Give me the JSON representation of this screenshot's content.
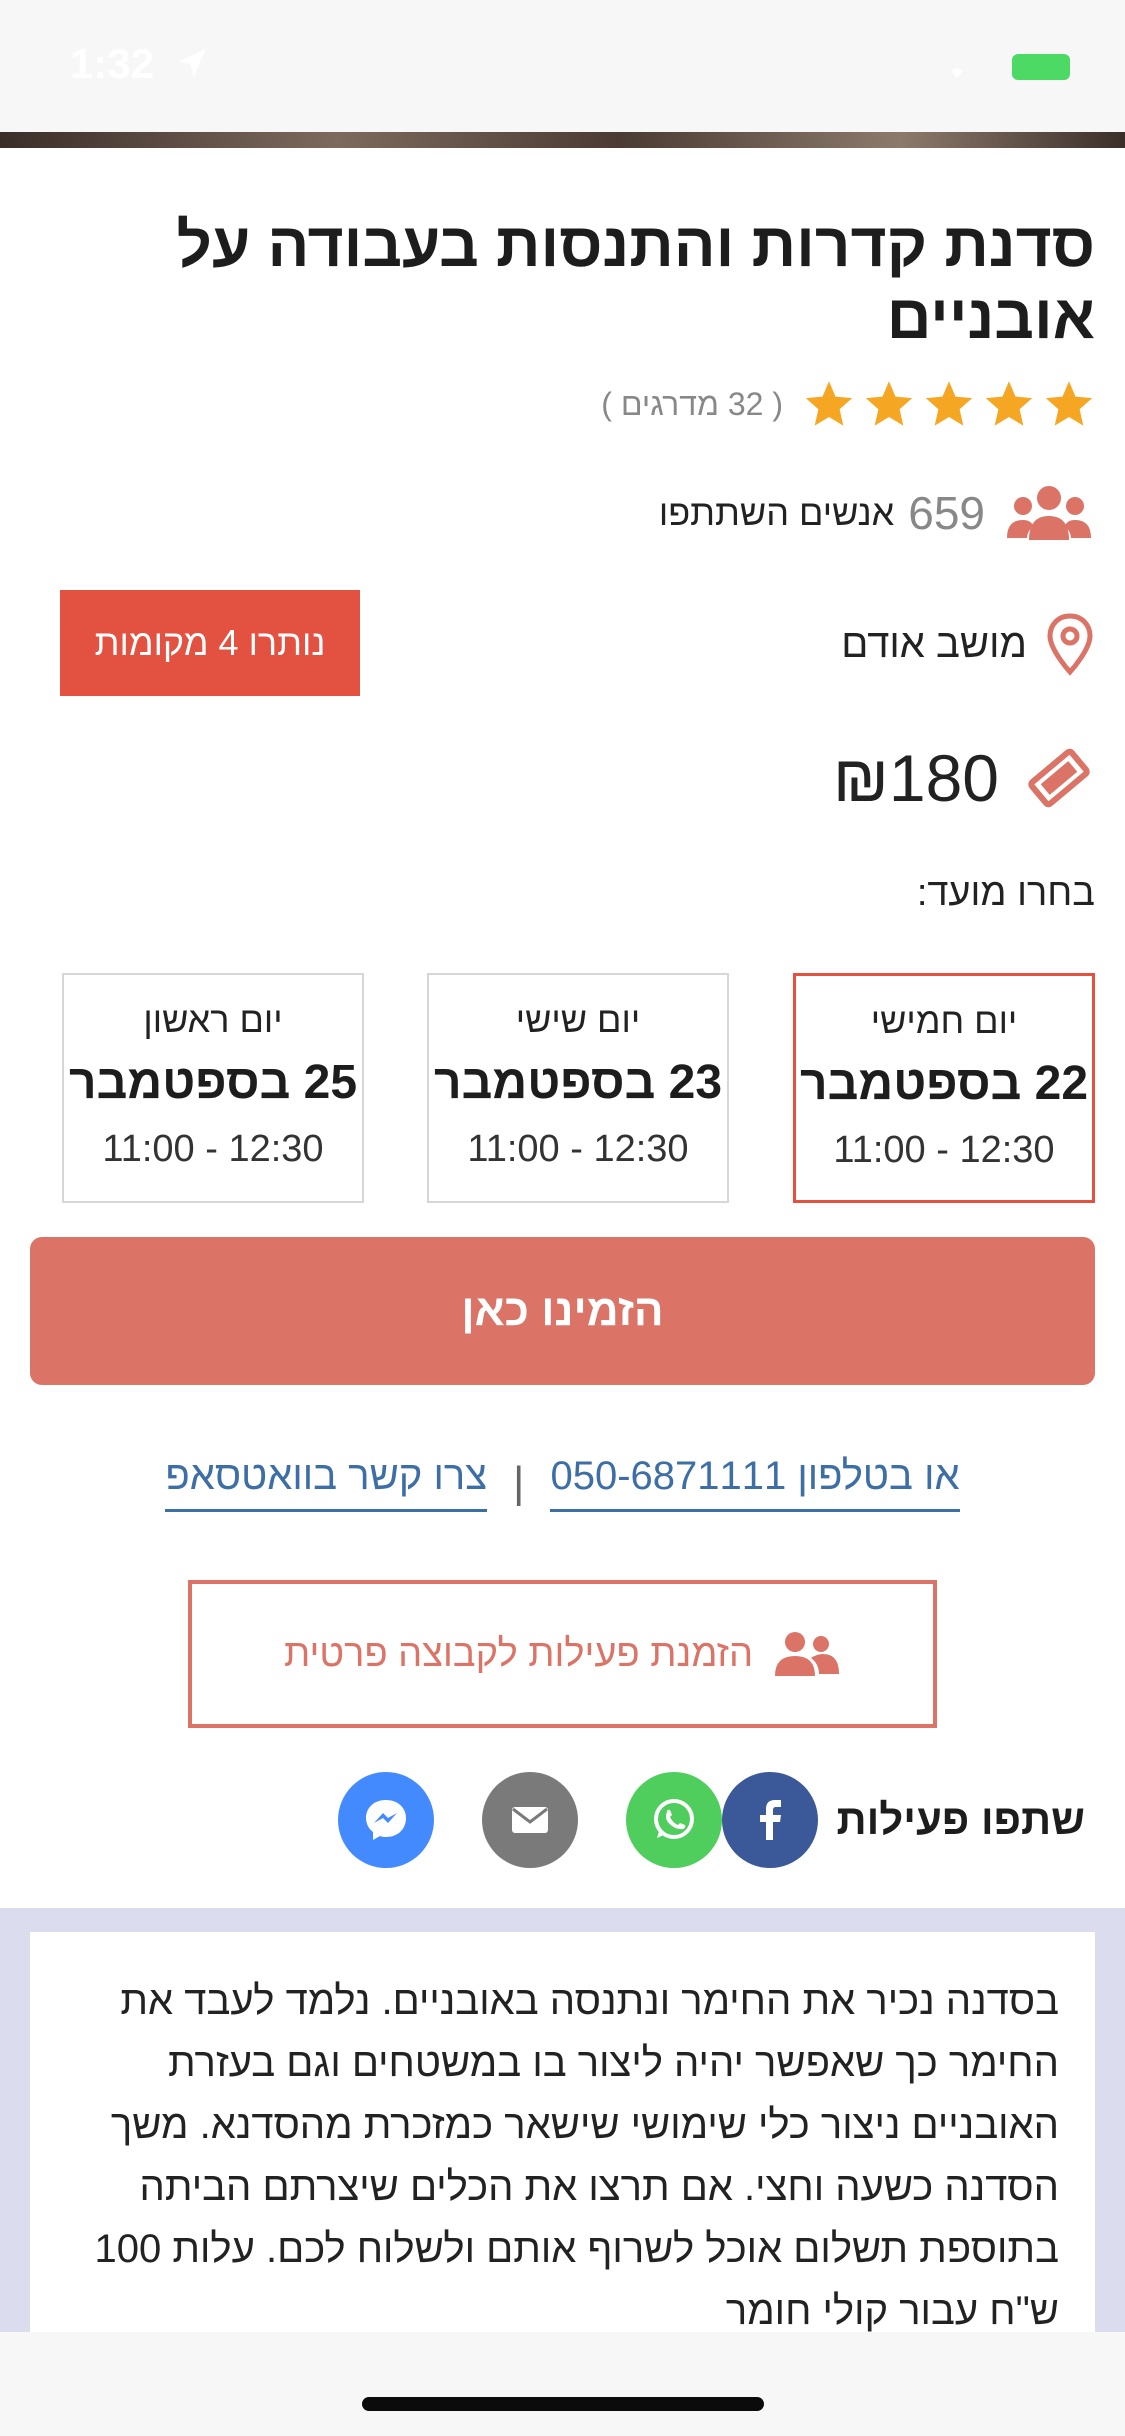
{
  "status_bar": {
    "time": "1:32"
  },
  "activity": {
    "title": "סדנת קדרות והתנסות בעבודה על אובניים",
    "rating_stars": 5,
    "rating_count": "( 32 מדרגים )",
    "participants_count": "659",
    "participants_label": "אנשים השתתפו",
    "location": "מושב אודם",
    "spots_left": "נותרו 4 מקומות",
    "price": "₪180"
  },
  "schedule": {
    "label": "בחרו מועד:",
    "dates": [
      {
        "day": "יום חמישי",
        "date": "22 בספטמבר",
        "time": "11:00 - 12:30",
        "selected": true
      },
      {
        "day": "יום שישי",
        "date": "23 בספטמבר",
        "time": "11:00 - 12:30",
        "selected": false
      },
      {
        "day": "יום ראשון",
        "date": "25 בספטמבר",
        "time": "11:00 - 12:30",
        "selected": false
      }
    ]
  },
  "actions": {
    "book_label": "הזמינו כאן",
    "phone_label": "או בטלפון 050-6871111",
    "whatsapp_label": "צרו קשר בוואטסאפ",
    "separator": "|",
    "group_label": "הזמנת פעילות לקבוצה פרטית"
  },
  "share": {
    "label": "שתפו פעילות",
    "buttons": [
      {
        "name": "facebook-icon",
        "color": "#3b5998"
      },
      {
        "name": "whatsapp-icon",
        "color": "#4fce5d"
      },
      {
        "name": "email-icon",
        "color": "#7a7a7a"
      },
      {
        "name": "messenger-icon",
        "color": "#448aff"
      }
    ]
  },
  "description": "בסדנה נכיר את החימר ונתנסה באובניים. נלמד לעבד את החימר כך שאפשר יהיה ליצור בו במשטחים וגם בעזרת האובניים ניצור כלי שימושי שישאר כמזכרת מהסדנא. משך הסדנה כשעה וחצי. אם תרצו את הכלים שיצרתם הביתה בתוספת תשלום אוכל לשרוף אותם ולשלוח לכם. עלות 100 ש\"ח עבור קולי חומר",
  "colors": {
    "accent": "#e35240",
    "button": "#db7366",
    "link": "#3d6ea6",
    "star": "#f5a623",
    "description_bg": "#dcdcef"
  }
}
